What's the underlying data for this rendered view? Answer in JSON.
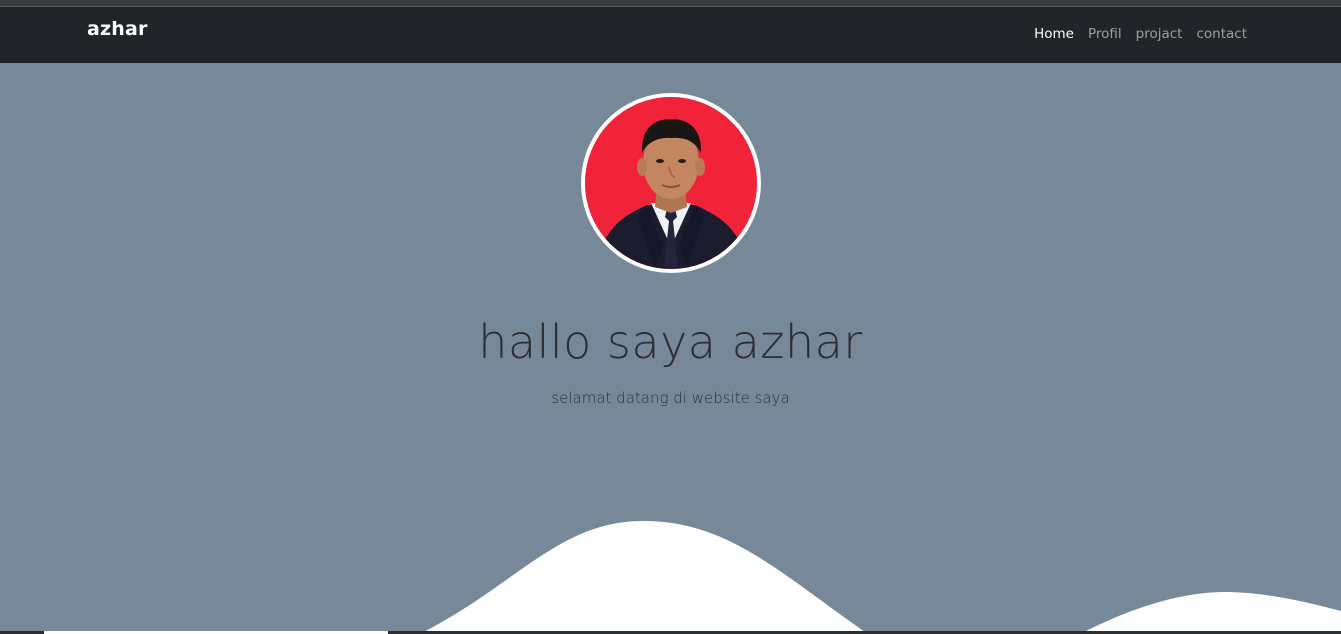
{
  "navbar": {
    "brand": "azhar",
    "links": [
      {
        "label": "Home",
        "active": true
      },
      {
        "label": "Profil",
        "active": false
      },
      {
        "label": "projact",
        "active": false
      },
      {
        "label": "contact",
        "active": false
      }
    ]
  },
  "hero": {
    "title": "hallo saya azhar",
    "subtitle": "selamat datang di website saya"
  },
  "colors": {
    "navbar_bg": "#212529",
    "hero_bg": "#778899",
    "photo_bg": "#f0233a",
    "wave": "#ffffff"
  }
}
